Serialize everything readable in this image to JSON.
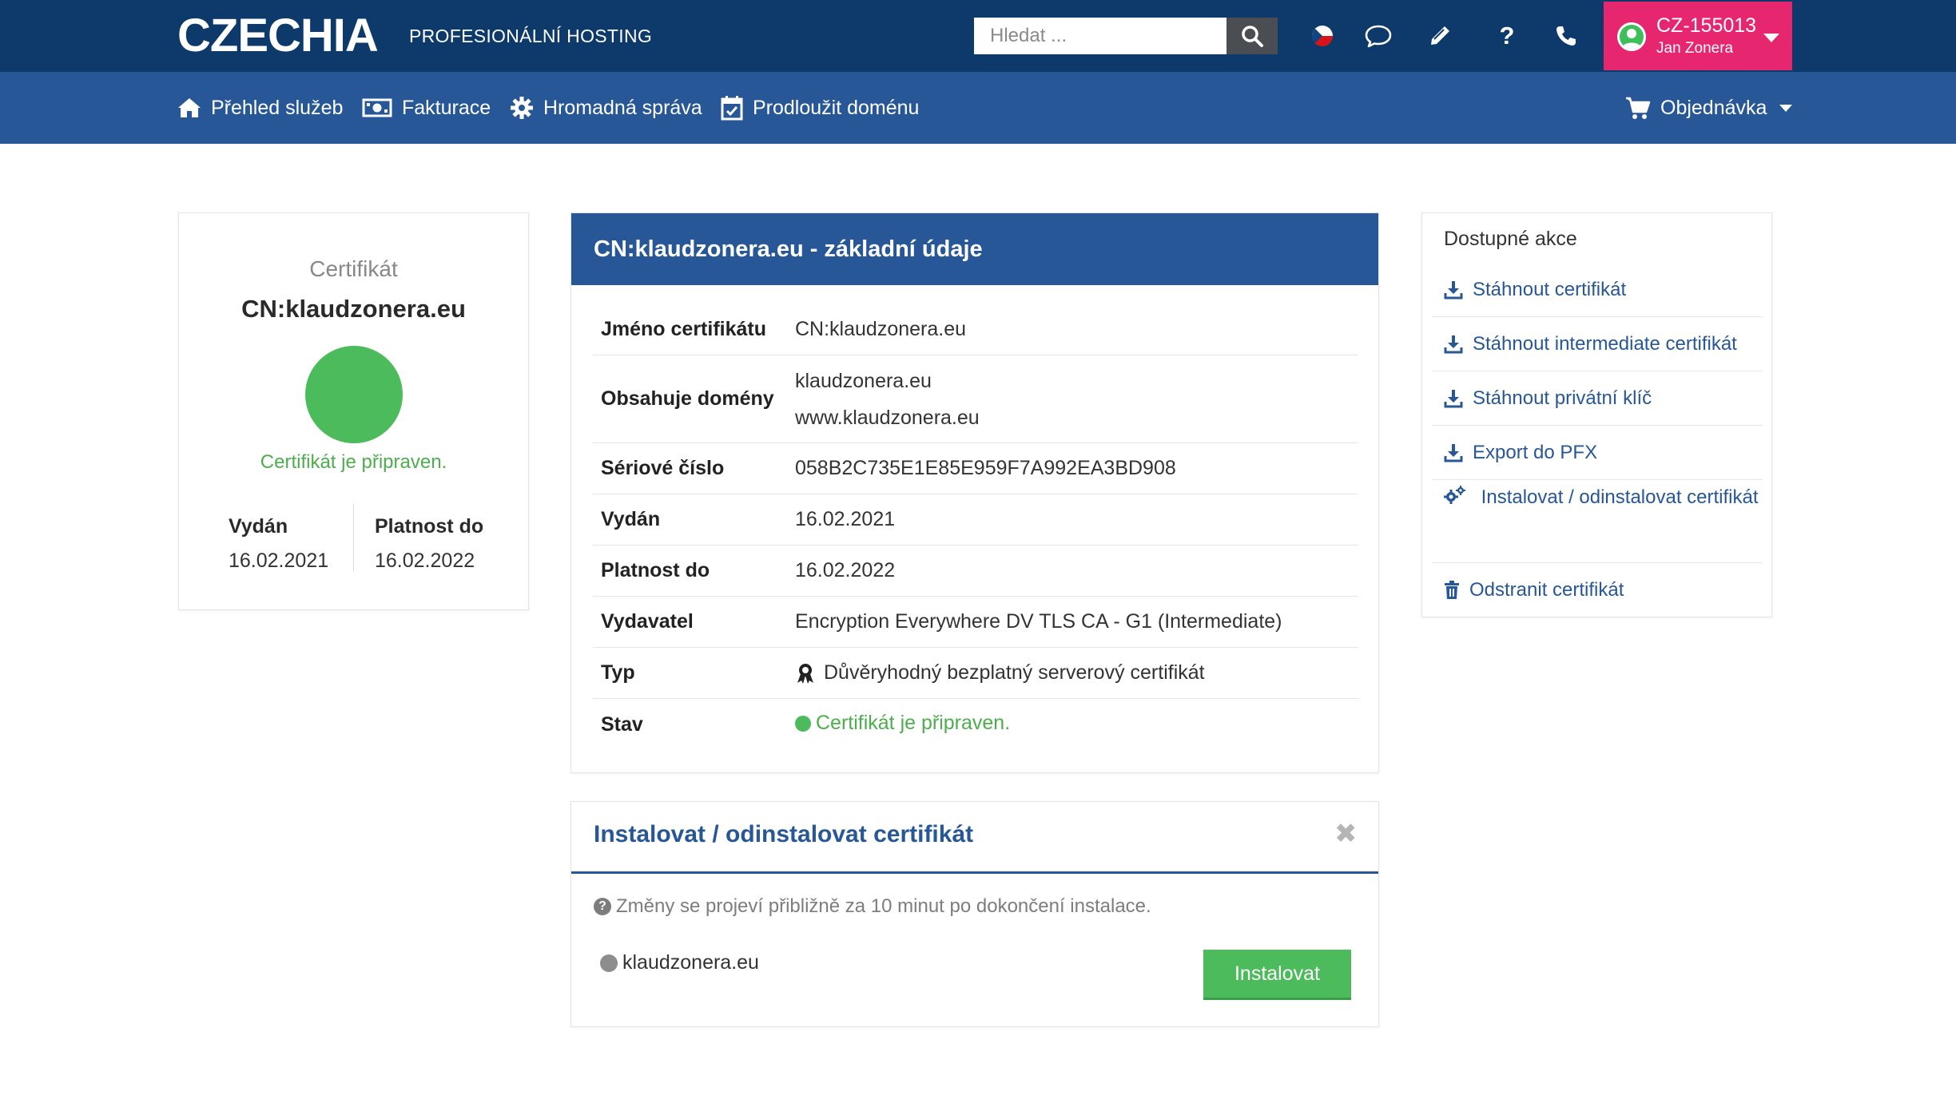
{
  "header": {
    "logo": "CZECHIA",
    "tagline": "PROFESIONÁLNÍ HOSTING",
    "search_placeholder": "Hledat ...",
    "icons": [
      "search-icon",
      "czech-flag-icon",
      "chat-icon",
      "pencil-icon",
      "help-icon",
      "phone-icon"
    ],
    "account": {
      "code": "CZ-155013",
      "name": "Jan Zonera"
    }
  },
  "nav": {
    "items": [
      {
        "label": "Přehled služeb",
        "icon": "home-icon"
      },
      {
        "label": "Fakturace",
        "icon": "money-icon"
      },
      {
        "label": "Hromadná správa",
        "icon": "gear-icon"
      },
      {
        "label": "Prodloužit doménu",
        "icon": "calendar-check-icon"
      }
    ],
    "order": {
      "label": "Objednávka",
      "icon": "cart-icon"
    }
  },
  "summary": {
    "label": "Certifikát",
    "cn": "CN:klaudzonera.eu",
    "status": "Certifikát je připraven.",
    "issued_label": "Vydán",
    "issued": "16.02.2021",
    "valid_label": "Platnost do",
    "valid": "16.02.2022"
  },
  "details": {
    "title": "CN:klaudzonera.eu - základní údaje",
    "rows": [
      {
        "key": "Jméno certifikátu",
        "value": "CN:klaudzonera.eu"
      },
      {
        "key": "Obsahuje domény",
        "values": [
          "klaudzonera.eu",
          "www.klaudzonera.eu"
        ]
      },
      {
        "key": "Sériové číslo",
        "value": "058B2C735E1E85E959F7A992EA3BD908"
      },
      {
        "key": "Vydán",
        "value": "16.02.2021"
      },
      {
        "key": "Platnost do",
        "value": "16.02.2022"
      },
      {
        "key": "Vydavatel",
        "value": "Encryption Everywhere DV TLS CA - G1 (Intermediate)"
      },
      {
        "key": "Typ",
        "value": "Důvěryhodný bezplatný serverový certifikát"
      },
      {
        "key": "Stav",
        "value": "Certifikát je připraven."
      }
    ]
  },
  "install": {
    "title": "Instalovat / odinstalovat certifikát",
    "help": "Změny se projeví přibližně za 10 minut po dokončení instalace.",
    "domain": "klaudzonera.eu",
    "button": "Instalovat"
  },
  "actions": {
    "title": "Dostupné akce",
    "items": [
      {
        "label": "Stáhnout certifikát",
        "icon": "download-icon"
      },
      {
        "label": "Stáhnout intermediate certifikát",
        "icon": "download-icon"
      },
      {
        "label": "Stáhnout privátní klíč",
        "icon": "download-icon"
      },
      {
        "label": "Export do PFX",
        "icon": "download-icon"
      },
      {
        "label": "Instalovat / odinstalovat certifikát",
        "icon": "gears-icon"
      },
      {
        "label": "Odstranit certifikát",
        "icon": "trash-icon"
      }
    ]
  },
  "colors": {
    "topbar": "#0d3a6b",
    "navbar": "#275796",
    "account": "#e6266f",
    "success": "#4cbb5b",
    "link": "#275796"
  }
}
